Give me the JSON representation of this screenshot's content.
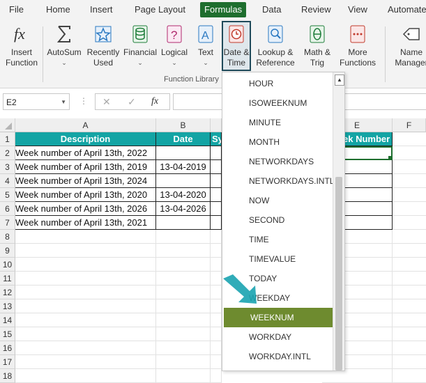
{
  "menubar": {
    "items": [
      "File",
      "Home",
      "Insert",
      "Page Layout",
      "Formulas",
      "Data",
      "Review",
      "View",
      "Automate"
    ],
    "active": "Formulas"
  },
  "ribbon": {
    "insert_function": {
      "line1": "Insert",
      "line2": "Function",
      "icon": "fx-icon"
    },
    "autosum": {
      "label": "AutoSum",
      "icon": "sigma-icon"
    },
    "recently_used": {
      "line1": "Recently",
      "line2": "Used",
      "icon": "star-icon"
    },
    "financial": {
      "label": "Financial",
      "icon": "coins-icon"
    },
    "logical": {
      "label": "Logical",
      "icon": "question-icon"
    },
    "text": {
      "label": "Text",
      "icon": "text-icon"
    },
    "date_time": {
      "line1": "Date &",
      "line2": "Time",
      "icon": "clock-icon"
    },
    "lookup": {
      "line1": "Lookup &",
      "line2": "Reference",
      "icon": "magnifier-icon"
    },
    "math": {
      "line1": "Math &",
      "line2": "Trig",
      "icon": "theta-icon"
    },
    "more": {
      "line1": "More",
      "line2": "Functions",
      "icon": "more-icon"
    },
    "name_manager": {
      "line1": "Name",
      "line2": "Manager",
      "icon": "tag-icon"
    },
    "group_label": "Function Library"
  },
  "formula_bar": {
    "name_box": "E2",
    "cancel_glyph": "✕",
    "enter_glyph": "✓",
    "fx_glyph": "fx",
    "formula": ""
  },
  "sheet": {
    "columns": [
      "A",
      "B",
      "E",
      "F"
    ],
    "header_row": {
      "a": "Description",
      "b": "Date",
      "c_partial": "Sy",
      "e_partial": "ek Number"
    },
    "rows": [
      {
        "num": "1"
      },
      {
        "num": "2",
        "a": "Week number of April 13th, 2022",
        "b": ""
      },
      {
        "num": "3",
        "a": "Week number of April 13th, 2019",
        "b": "13-04-2019"
      },
      {
        "num": "4",
        "a": "Week number of April 13th, 2024",
        "b": ""
      },
      {
        "num": "5",
        "a": "Week number of April 13th, 2020",
        "b": "13-04-2020"
      },
      {
        "num": "6",
        "a": "Week number of April 13th, 2026",
        "b": "13-04-2026"
      },
      {
        "num": "7",
        "a": "Week number of April 13th, 2021",
        "b": ""
      },
      {
        "num": "8"
      },
      {
        "num": "9"
      },
      {
        "num": "10"
      },
      {
        "num": "11"
      },
      {
        "num": "12"
      },
      {
        "num": "13"
      },
      {
        "num": "14"
      },
      {
        "num": "15"
      },
      {
        "num": "16"
      },
      {
        "num": "17"
      },
      {
        "num": "18"
      }
    ]
  },
  "dropdown": {
    "items": [
      "HOUR",
      "ISOWEEKNUM",
      "MINUTE",
      "MONTH",
      "NETWORKDAYS",
      "NETWORKDAYS.INTL",
      "NOW",
      "SECOND",
      "TIME",
      "TIMEVALUE",
      "TODAY",
      "WEEKDAY",
      "WEEKNUM",
      "WORKDAY",
      "WORKDAY.INTL"
    ],
    "selected": "WEEKNUM",
    "scroll_up_glyph": "▲"
  },
  "colors": {
    "accent_green": "#1e6e2e",
    "header_teal": "#13a4a4",
    "selected_item": "#6e8b2f",
    "pointer_arrow": "#1aa3b0"
  }
}
